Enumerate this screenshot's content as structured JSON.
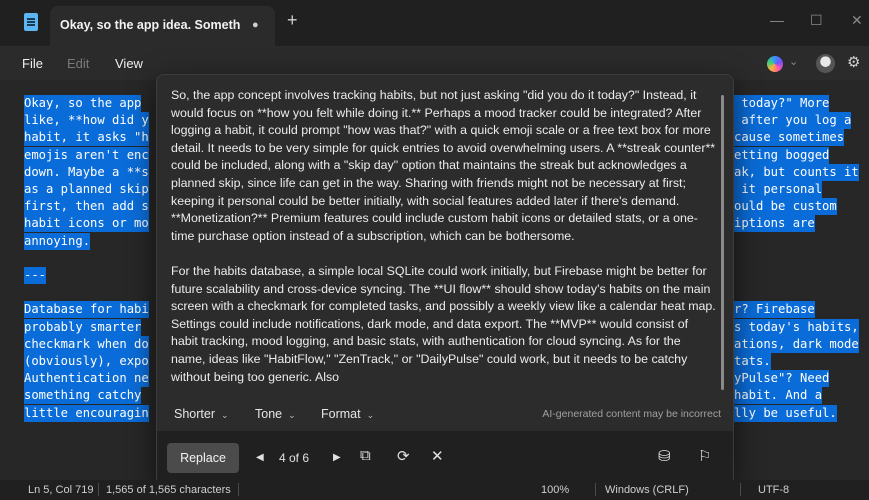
{
  "tab": {
    "title": "Okay, so the app idea. Something a",
    "modified": "●",
    "new_tab": "+"
  },
  "window_controls": {
    "minimize": "—",
    "maximize": "☐",
    "close": "✕"
  },
  "menu": {
    "file": "File",
    "edit": "Edit",
    "view": "View"
  },
  "icons": {
    "copilot": "copilot-icon",
    "chevron": "⌄",
    "settings": "⚙"
  },
  "editor": {
    "left_lines": [
      "Okay, so the app",
      "like, **how did y",
      "habit, it asks \"h",
      "emojis aren't enc",
      "down. Maybe a **s",
      "as a planned skip",
      "first, then add s",
      "habit icons or mo",
      "annoying.",
      "",
      "---",
      "",
      "Database for habi",
      "probably smarter",
      "checkmark when do",
      "(obviously), expo",
      "Authentication ne",
      "something catchy",
      "little encouragin"
    ],
    "right_lines": [
      " today?\" More",
      " after you log a",
      "cause sometimes",
      "etting bogged",
      "ak, but counts it",
      " it personal",
      "ould be custom",
      "iptions are",
      "",
      "",
      "",
      "",
      "r? Firebase",
      "s today's habits,",
      "ations, dark mode",
      "tats.",
      "yPulse\"? Need",
      "habit. And a",
      "lly be useful."
    ]
  },
  "rewrite": {
    "paragraph1": "So, the app concept involves tracking habits, but not just asking \"did you do it today?\" Instead, it would focus on **how you felt while doing it.** Perhaps a mood tracker could be integrated? After logging a habit, it could prompt \"how was that?\" with a quick emoji scale or a free text box for more detail. It needs to be very simple for quick entries to avoid overwhelming users. A **streak counter** could be included, along with a \"skip day\" option that maintains the streak but acknowledges a planned skip, since life can get in the way. Sharing with friends might not be necessary at first; keeping it personal could be better initially, with social features added later if there's demand. **Monetization?** Premium features could include custom habit icons or detailed stats, or a one-time purchase option instead of a subscription, which can be bothersome.",
    "paragraph2": "For the habits database, a simple local SQLite could work initially, but Firebase might be better for future scalability and cross-device syncing. The **UI flow** should show today's habits on the main screen with a checkmark for completed tasks, and possibly a weekly view like a calendar heat map. Settings could include notifications, dark mode, and data export. The **MVP** would consist of habit tracking, mood logging, and basic stats, with authentication for cloud syncing. As for the name, ideas like \"HabitFlow,\" \"ZenTrack,\" or \"DailyPulse\" could work, but it needs to be catchy without being too generic. Also",
    "options": {
      "shorter": "Shorter",
      "tone": "Tone",
      "format": "Format",
      "chevron": "⌄"
    },
    "disclaimer": "AI-generated content may be incorrect",
    "replace_label": "Replace",
    "prev": "◀",
    "next": "▶",
    "counter": "4 of 6",
    "copy_icon": "⧉",
    "regenerate_icon": "⟳",
    "dismiss_icon": "✕",
    "stack_icon": "⛁",
    "flag_icon": "⚐"
  },
  "status": {
    "position": "Ln 5, Col 719",
    "characters": "1,565 of 1,565 characters",
    "zoom": "100%",
    "line_ending": "Windows (CRLF)",
    "encoding": "UTF-8"
  }
}
